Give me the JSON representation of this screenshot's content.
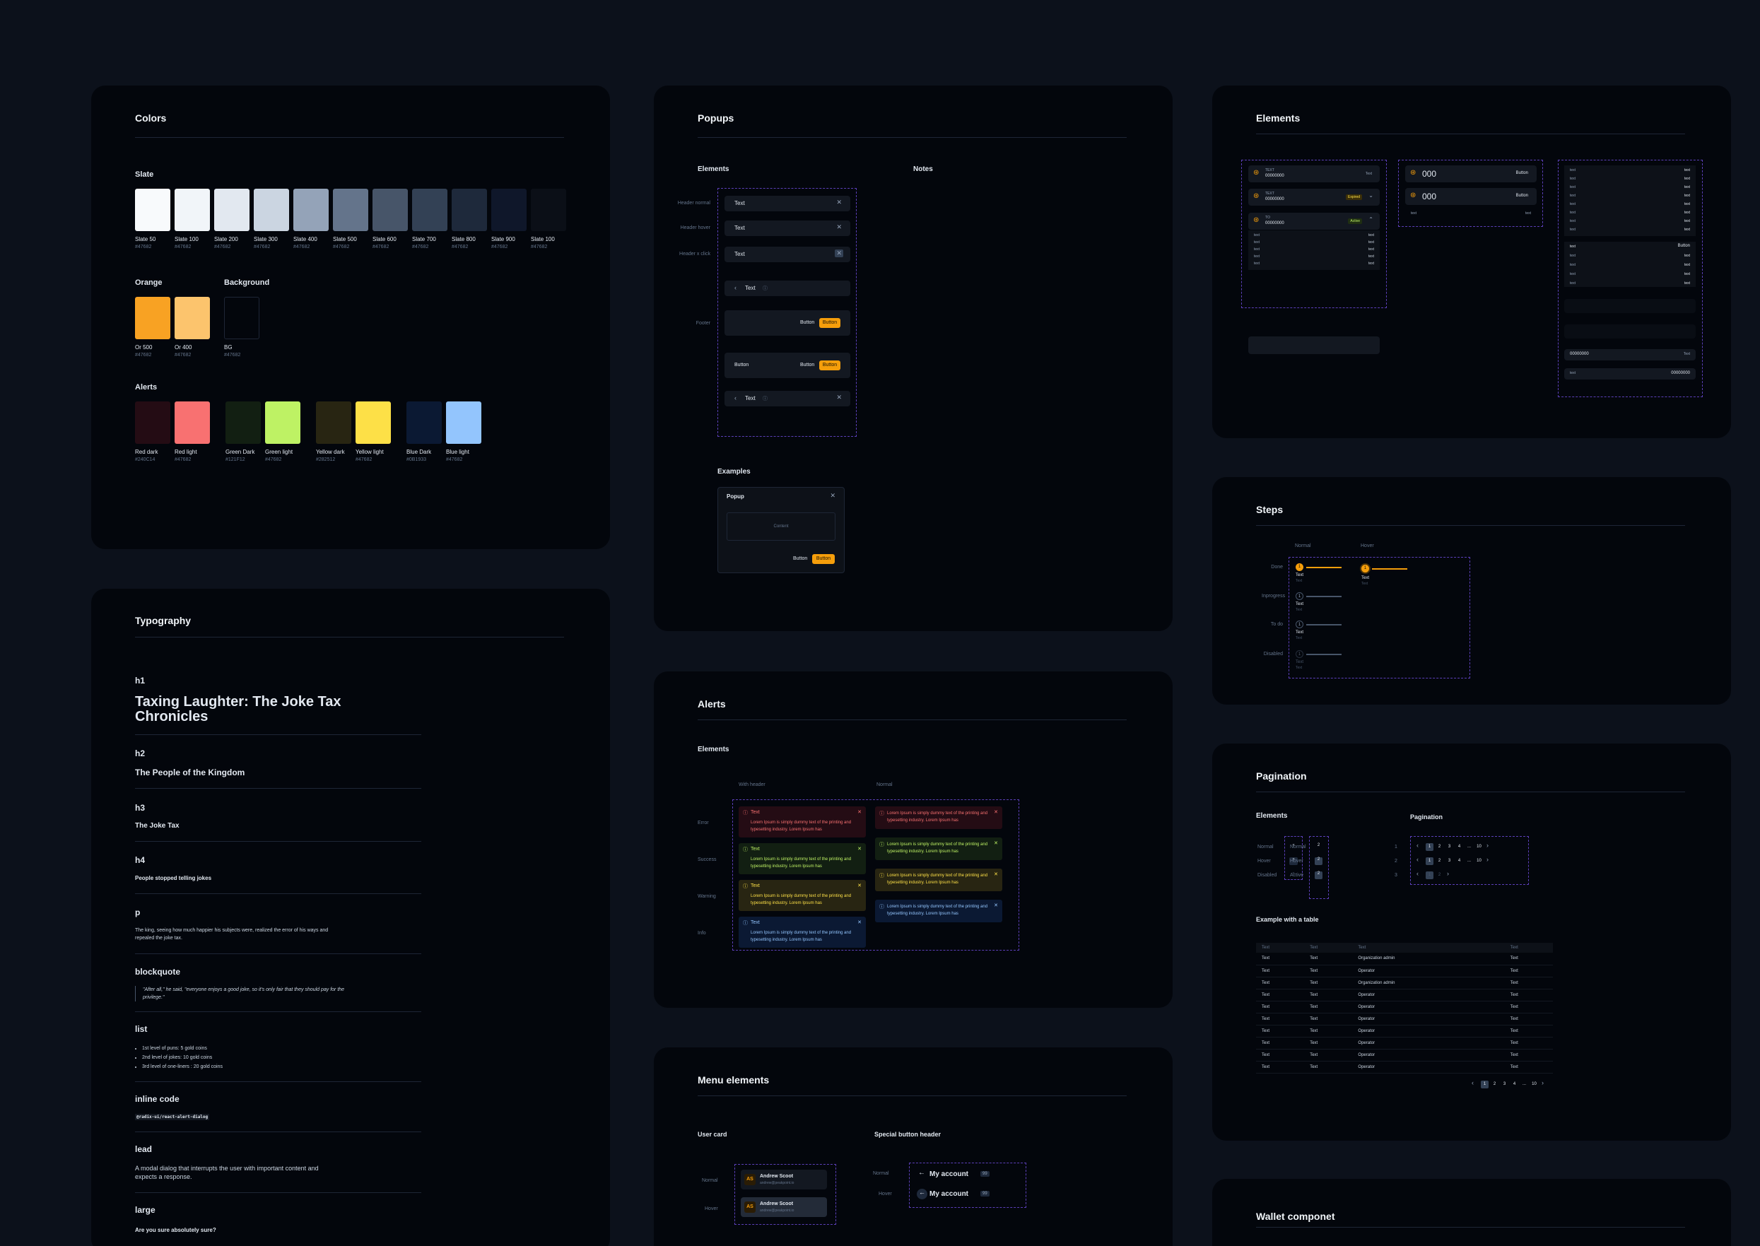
{
  "colors": {
    "title": "Colors",
    "slate_label": "Slate",
    "slate": [
      {
        "name": "Slate 50",
        "hex": "#47682",
        "c": "#f8fafc"
      },
      {
        "name": "Slate 100",
        "hex": "#47682",
        "c": "#f1f5f9"
      },
      {
        "name": "Slate 200",
        "hex": "#47682",
        "c": "#e2e8f0"
      },
      {
        "name": "Slate 300",
        "hex": "#47682",
        "c": "#cbd5e1"
      },
      {
        "name": "Slate 400",
        "hex": "#47682",
        "c": "#94a3b8"
      },
      {
        "name": "Slate 500",
        "hex": "#47682",
        "c": "#64748b"
      },
      {
        "name": "Slate 600",
        "hex": "#47682",
        "c": "#475569"
      },
      {
        "name": "Slate 700",
        "hex": "#47682",
        "c": "#334155"
      },
      {
        "name": "Slate 800",
        "hex": "#47682",
        "c": "#1e293b"
      },
      {
        "name": "Slate 900",
        "hex": "#47682",
        "c": "#0f172a"
      },
      {
        "name": "Slate 100",
        "hex": "#47682",
        "c": "#0b0f17"
      }
    ],
    "orange_label": "Orange",
    "background_label": "Background",
    "orange": [
      {
        "name": "Or 500",
        "hex": "#47682",
        "c": "#f8a223"
      },
      {
        "name": "Or 400",
        "hex": "#47682",
        "c": "#fcc46d"
      }
    ],
    "background": [
      {
        "name": "BG",
        "hex": "#47682",
        "c": "#03060c"
      }
    ],
    "alerts_label": "Alerts",
    "alerts": [
      {
        "name": "Red dark",
        "hex": "#240C14",
        "c": "#240c14"
      },
      {
        "name": "Red light",
        "hex": "#47682",
        "c": "#f87171"
      },
      {
        "name": "Green Dark",
        "hex": "#121F12",
        "c": "#121f12"
      },
      {
        "name": "Green light",
        "hex": "#47682",
        "c": "#bef264"
      },
      {
        "name": "Yellow dark",
        "hex": "#282512",
        "c": "#282512"
      },
      {
        "name": "Yellow light",
        "hex": "#47682",
        "c": "#fde047"
      },
      {
        "name": "Blue Dark",
        "hex": "#0B1933",
        "c": "#0b1933"
      },
      {
        "name": "Blue light",
        "hex": "#47682",
        "c": "#93c5fd"
      }
    ]
  },
  "typography": {
    "title": "Typography",
    "h1_label": "h1",
    "h1": "Taxing Laughter: The Joke Tax Chronicles",
    "h2_label": "h2",
    "h2": "The People of the Kingdom",
    "h3_label": "h3",
    "h3": "The Joke Tax",
    "h4_label": "h4",
    "h4": "People stopped telling jokes",
    "p_label": "p",
    "p": "The king, seeing how much happier his subjects were, realized the error of his ways and repealed the joke tax.",
    "bq_label": "blockquote",
    "bq": "\"After all,\" he said, \"everyone enjoys a good joke, so it's only fair that they should pay for the privilege.\"",
    "list_label": "list",
    "list": [
      "1st level of puns: 5 gold coins",
      "2nd level of jokes: 10 gold coins",
      "3rd level of one-liners : 20 gold coins"
    ],
    "code_label": "inline code",
    "code": "@radix-ui/react-alert-dialog",
    "lead_label": "lead",
    "lead": "A modal dialog that interrupts the user with important content and expects a response.",
    "large_label": "large",
    "large": "Are you sure absolutely sure?"
  },
  "popups": {
    "title": "Popups",
    "elements_label": "Elements",
    "notes_label": "Notes",
    "row_labels": [
      "Header normal",
      "Header hover",
      "Header x click",
      "Footer"
    ],
    "text": "Text",
    "button": "Button",
    "examples_label": "Examples",
    "popup_title": "Popup",
    "content": "Content"
  },
  "alerts": {
    "title": "Alerts",
    "elements_label": "Elements",
    "col_with_header": "With header",
    "col_normal": "Normal",
    "types": [
      "Error",
      "Success",
      "Warning",
      "Info"
    ],
    "head": "Text",
    "body": "Lorem Ipsum is simply dummy text of the printing and typesetting industry. Lorem Ipsum has",
    "colors": {
      "error_bg": "#240c14",
      "error_fg": "#f87171",
      "success_bg": "#121f12",
      "success_fg": "#bef264",
      "warning_bg": "#282512",
      "warning_fg": "#fde047",
      "info_bg": "#0b1933",
      "info_fg": "#93c5fd"
    }
  },
  "menu": {
    "title": "Menu elements",
    "user_card_label": "User card",
    "special_label": "Special button header",
    "states": [
      "Normal",
      "Hover"
    ],
    "initials": "AS",
    "user_name": "Andrew Scoot",
    "user_email": "andrew@peakpoint.io",
    "my_account": "My account",
    "badge": "99"
  },
  "elements": {
    "title": "Elements",
    "text_caps": "TEXT",
    "num": "00000000",
    "badge_text": "Text",
    "expired": "Expired",
    "active": "Active",
    "big_num": "000",
    "button": "Button",
    "small_text": "text",
    "to": "TO"
  },
  "steps": {
    "title": "Steps",
    "col_normal": "Normal",
    "col_hover": "Hover",
    "rows": [
      "Done",
      "Inprogress",
      "To do",
      "Disabled"
    ],
    "text": "Text",
    "sub": "Text"
  },
  "pagination": {
    "title": "Pagination",
    "elements_label": "Elements",
    "pagination_label": "Pagination",
    "states": [
      "Normal",
      "Hover",
      "Disabled"
    ],
    "states2": [
      "Normal",
      "Hover",
      "Active"
    ],
    "pages": [
      "1",
      "2",
      "3",
      "4",
      "...",
      "10"
    ],
    "rows": [
      "1",
      "2",
      "3"
    ],
    "table_label": "Example with a table",
    "table_headers": [
      "Text",
      "Text",
      "Text",
      "Text"
    ],
    "table_rows": [
      [
        "Text",
        "Text",
        "Organization admin",
        "Text"
      ],
      [
        "Text",
        "Text",
        "Operator",
        "Text"
      ],
      [
        "Text",
        "Text",
        "Organization admin",
        "Text"
      ],
      [
        "Text",
        "Text",
        "Operator",
        "Text"
      ],
      [
        "Text",
        "Text",
        "Operator",
        "Text"
      ],
      [
        "Text",
        "Text",
        "Operator",
        "Text"
      ],
      [
        "Text",
        "Text",
        "Operator",
        "Text"
      ],
      [
        "Text",
        "Text",
        "Operator",
        "Text"
      ],
      [
        "Text",
        "Text",
        "Operator",
        "Text"
      ],
      [
        "Text",
        "Text",
        "Operator",
        "Text"
      ]
    ],
    "table_pages": [
      "1",
      "2",
      "3",
      "4",
      "...",
      "10"
    ]
  },
  "wallet": {
    "title": "Wallet componet"
  }
}
